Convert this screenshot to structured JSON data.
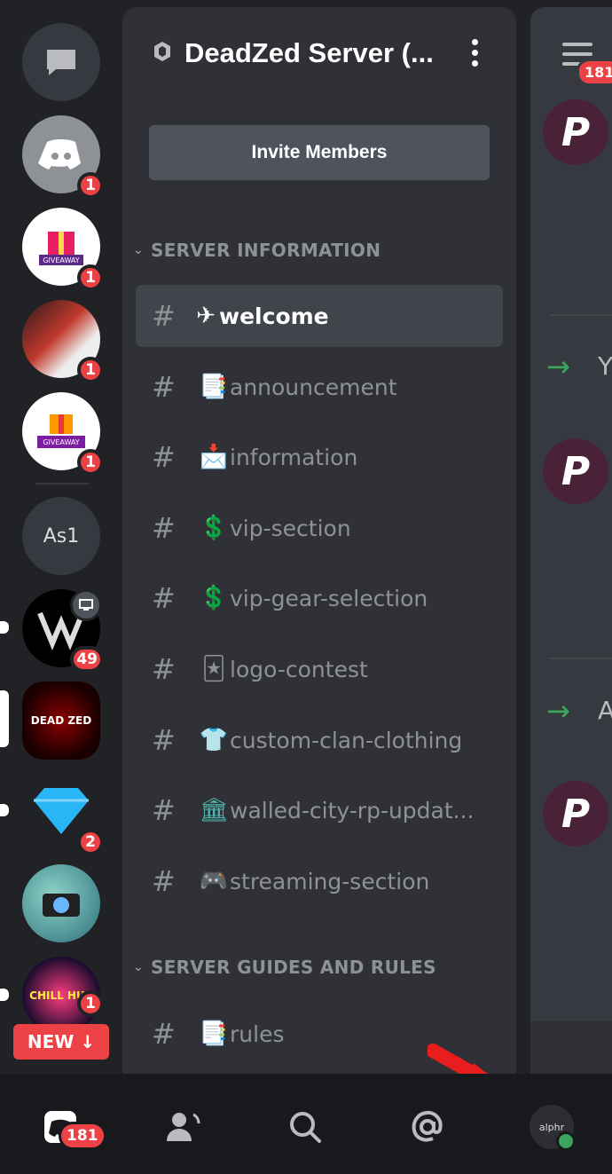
{
  "servers": [
    {
      "name": "direct-messages",
      "icon": "chat-bubble-icon"
    },
    {
      "name": "discord-home",
      "badge": "1"
    },
    {
      "name": "giveaway-server-1",
      "label": "GIVEAWAY",
      "badge": "1"
    },
    {
      "name": "anime-avatar-server",
      "badge": "1"
    },
    {
      "name": "giveaway-server-2",
      "label": "GIVEAWAY",
      "badge": "1"
    },
    {
      "name": "as1-server",
      "label": "As1"
    },
    {
      "name": "vs-logo-server",
      "badge": "49"
    },
    {
      "name": "deadzed-server",
      "label": "DEAD ZED"
    },
    {
      "name": "diamond-server",
      "badge": "2"
    },
    {
      "name": "photographer-server"
    },
    {
      "name": "chill-hub-server",
      "label": "CHILL HUB",
      "badge": "1"
    }
  ],
  "new_button": {
    "label": "NEW ↓"
  },
  "channel_panel": {
    "server_title": "DeadZed Server (...",
    "invite_label": "Invite Members",
    "categories": [
      {
        "label": "SERVER INFORMATION"
      },
      {
        "label": "SERVER GUIDES AND RULES"
      }
    ],
    "channels": [
      {
        "hash": "#",
        "emoji": "✈",
        "name": "welcome",
        "active": true
      },
      {
        "hash": "#",
        "emoji": "📑",
        "name": "announcement"
      },
      {
        "hash": "#",
        "emoji": "📩",
        "name": "information"
      },
      {
        "hash": "#",
        "emoji": "💲",
        "name": "vip-section"
      },
      {
        "hash": "#",
        "emoji": "💲",
        "name": "vip-gear-selection"
      },
      {
        "hash": "#",
        "emoji": "🃏",
        "name": "logo-contest"
      },
      {
        "hash": "#",
        "emoji": "👕",
        "name": "custom-clan-clothing"
      },
      {
        "hash": "#",
        "emoji": "🏛",
        "name": "walled-city-rp-updat..."
      },
      {
        "hash": "#",
        "emoji": "🎮",
        "name": "streaming-section"
      },
      {
        "hash": "#",
        "emoji": "📑",
        "name": "rules"
      }
    ]
  },
  "right_pane": {
    "badge": "181",
    "avatar_letter": "P",
    "peek_letters": [
      "Y",
      "A"
    ]
  },
  "tabbar": {
    "home_badge": "181",
    "profile_text": "alphr"
  },
  "colors": {
    "accent_red": "#ed4245",
    "online_green": "#3ba55d",
    "active_bg": "#40444b"
  }
}
